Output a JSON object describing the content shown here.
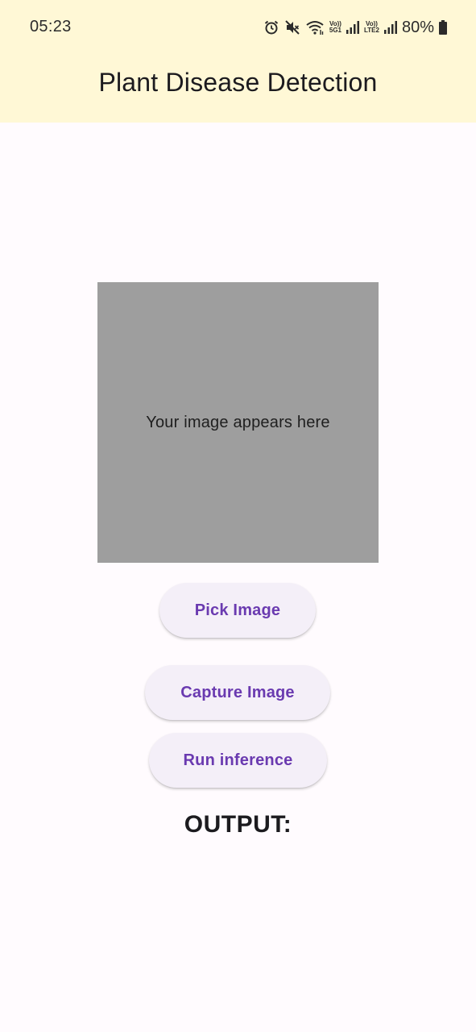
{
  "status_bar": {
    "time": "05:23",
    "icons": [
      "alarm-icon",
      "mute-icon",
      "wifi-icon",
      "volte-5g-icon",
      "signal-icon",
      "volte-lte2-icon",
      "signal-icon",
      "battery-icon"
    ],
    "network_1": {
      "top": "Vo))",
      "bottom": "5G1"
    },
    "network_2": {
      "top": "Vo))",
      "bottom": "LTE2"
    },
    "battery_percent": "80%"
  },
  "app_bar": {
    "title": "Plant Disease Detection",
    "background_color": "#fff8d6"
  },
  "image_area": {
    "placeholder_text": "Your image appears here",
    "background_color": "#9e9e9e"
  },
  "buttons": {
    "pick_image": "Pick Image",
    "capture_image": "Capture Image",
    "run_inference": "Run inference",
    "text_color": "#6a3ab0",
    "background_color": "#f4eff8"
  },
  "output": {
    "label": "OUTPUT:",
    "value": ""
  }
}
